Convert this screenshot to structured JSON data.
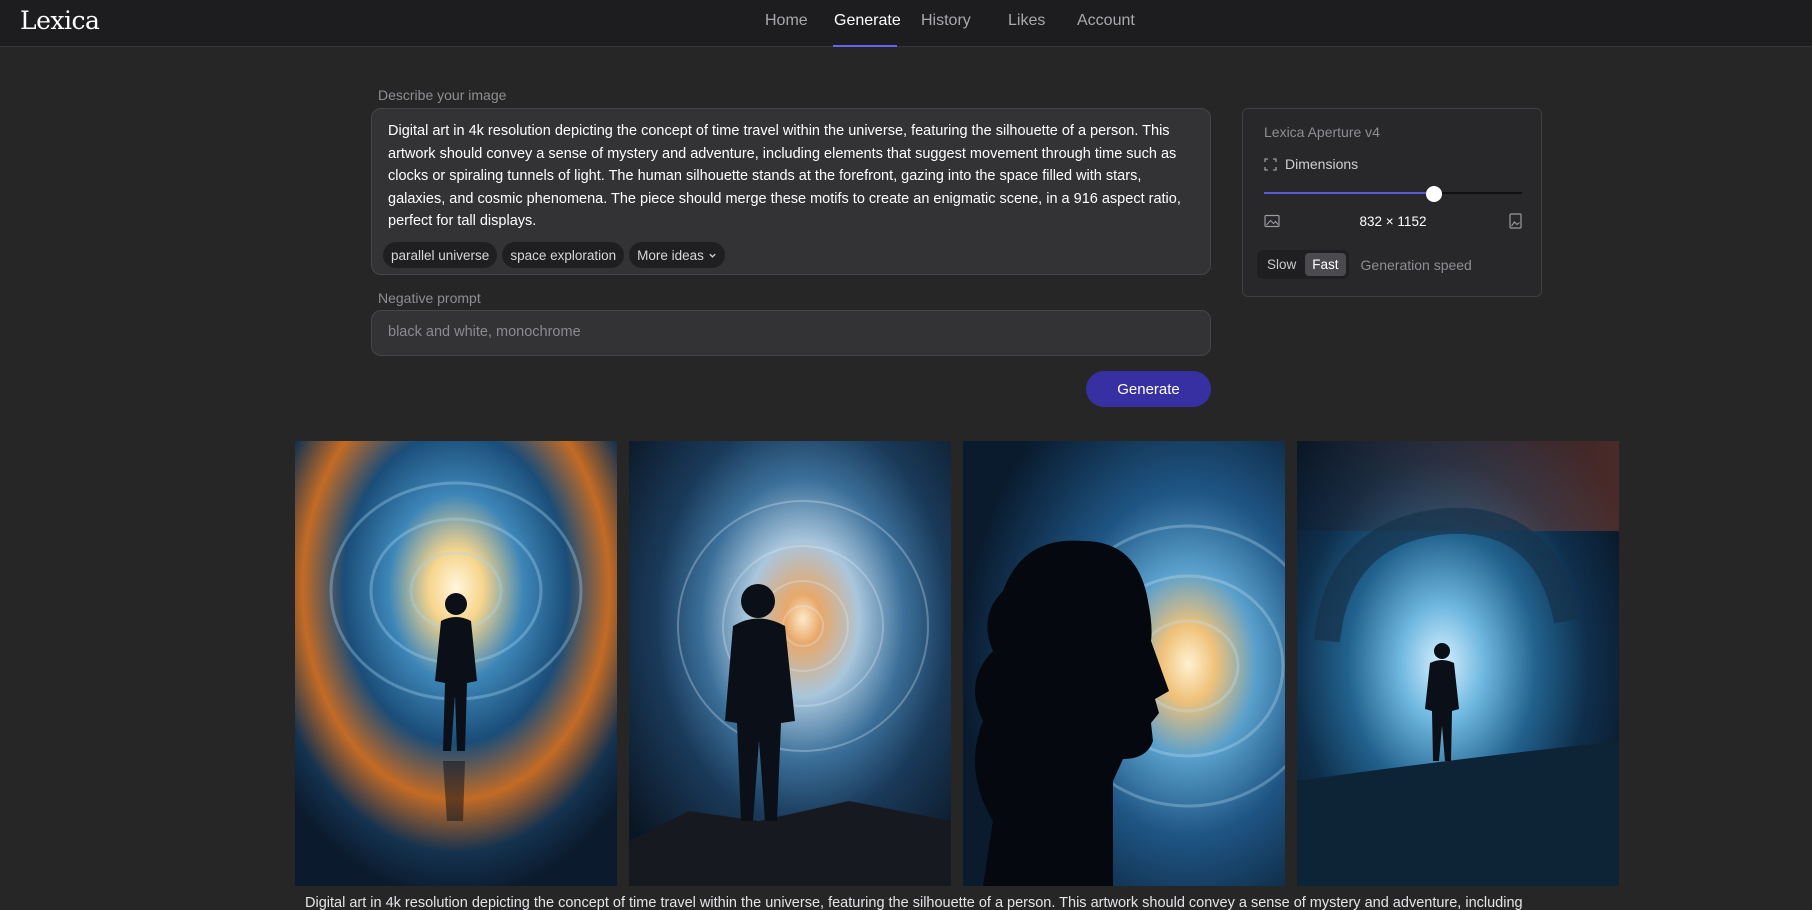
{
  "app": {
    "logo": "Lexica"
  },
  "nav": {
    "home": "Home",
    "generate": "Generate",
    "history": "History",
    "likes": "Likes",
    "account": "Account"
  },
  "prompt": {
    "label": "Describe your image",
    "text": "Digital art in 4k resolution depicting the concept of time travel within the universe, featuring the silhouette of a person. This artwork should convey a sense of mystery and adventure, including elements that suggest movement through time such as clocks or spiraling tunnels of light. The human silhouette stands at the forefront, gazing into the space filled with stars, galaxies, and cosmic phenomena. The piece should merge these motifs to create an enigmatic scene, in a 916 aspect ratio, perfect for tall displays.",
    "chips": [
      "parallel universe",
      "space exploration"
    ],
    "more_ideas": "More ideas"
  },
  "negative": {
    "label": "Negative prompt",
    "placeholder": "black and white, monochrome",
    "value": ""
  },
  "generate_button": "Generate",
  "settings": {
    "model": "Lexica Aperture v4",
    "dimensions_label": "Dimensions",
    "slider_level": 0.66,
    "size_text": "832 × 1152",
    "speed_options": [
      "Slow",
      "Fast"
    ],
    "speed_selected": "Fast",
    "speed_label": "Generation speed"
  },
  "gallery": {
    "images": [
      {
        "icon": "silhouette-walking-into-vortex"
      },
      {
        "icon": "silhouette-facing-spiral-tunnel"
      },
      {
        "icon": "head-profile-galaxy"
      },
      {
        "icon": "figure-in-cosmic-wave"
      }
    ],
    "caption": "Digital art in 4k resolution depicting the concept of time travel within the universe, featuring the silhouette of a person. This artwork should convey a sense of mystery and adventure, including"
  },
  "colors": {
    "accent": "#6366f1",
    "generate_button": "#3730a3",
    "background": "#262627"
  }
}
